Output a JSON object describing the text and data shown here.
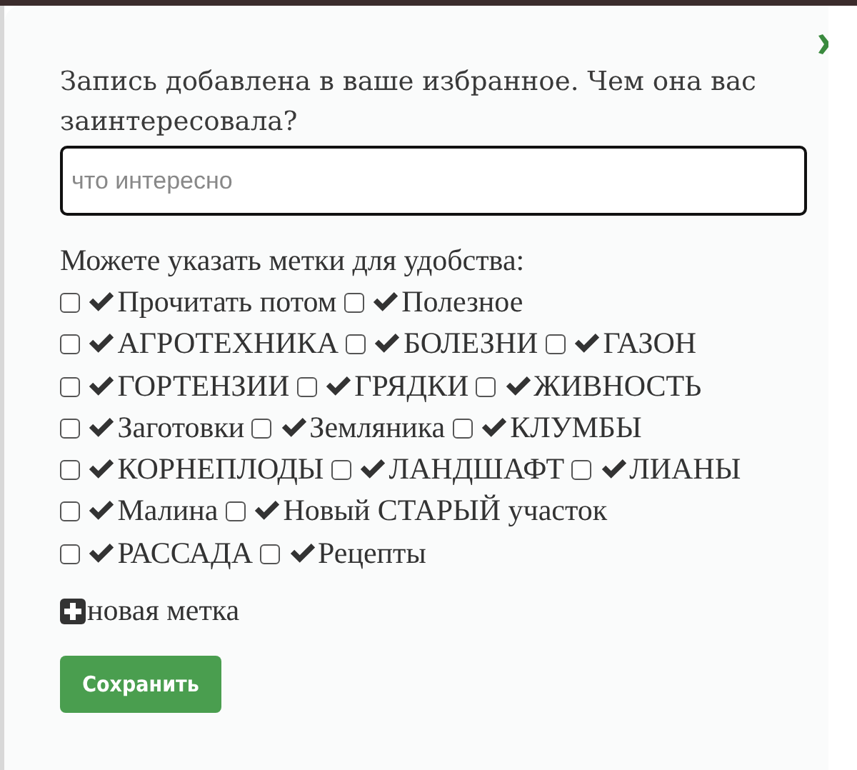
{
  "dialog": {
    "message": "Запись добавлена в ваше избранное. Чем она вас заинтересовала?",
    "comment_field": {
      "placeholder": "что интересно"
    },
    "tags_label": "Можете указать метки для удобства:",
    "tags": [
      {
        "label": "Прочитать потом",
        "checked": false
      },
      {
        "label": "Полезное",
        "checked": false
      },
      {
        "label": "АГРОТЕХНИКА",
        "checked": false
      },
      {
        "label": "БОЛЕЗНИ",
        "checked": false
      },
      {
        "label": "ГАЗОН",
        "checked": false
      },
      {
        "label": "ГОРТЕНЗИИ",
        "checked": false
      },
      {
        "label": "ГРЯДКИ",
        "checked": false
      },
      {
        "label": "ЖИВНОСТЬ",
        "checked": false
      },
      {
        "label": "Заготовки",
        "checked": false
      },
      {
        "label": "Земляника",
        "checked": false
      },
      {
        "label": "КЛУМБЫ",
        "checked": false
      },
      {
        "label": "КОРНЕПЛОДЫ",
        "checked": false
      },
      {
        "label": "ЛАНДШАФТ",
        "checked": false
      },
      {
        "label": "ЛИАНЫ",
        "checked": false
      },
      {
        "label": "Малина",
        "checked": false
      },
      {
        "label": "Новый СТАРЫЙ участок",
        "checked": false
      },
      {
        "label": "РАССАДА",
        "checked": false
      },
      {
        "label": "Рецепты",
        "checked": false
      }
    ],
    "add_tag": "новая метка",
    "save_button": "Сохранить"
  }
}
